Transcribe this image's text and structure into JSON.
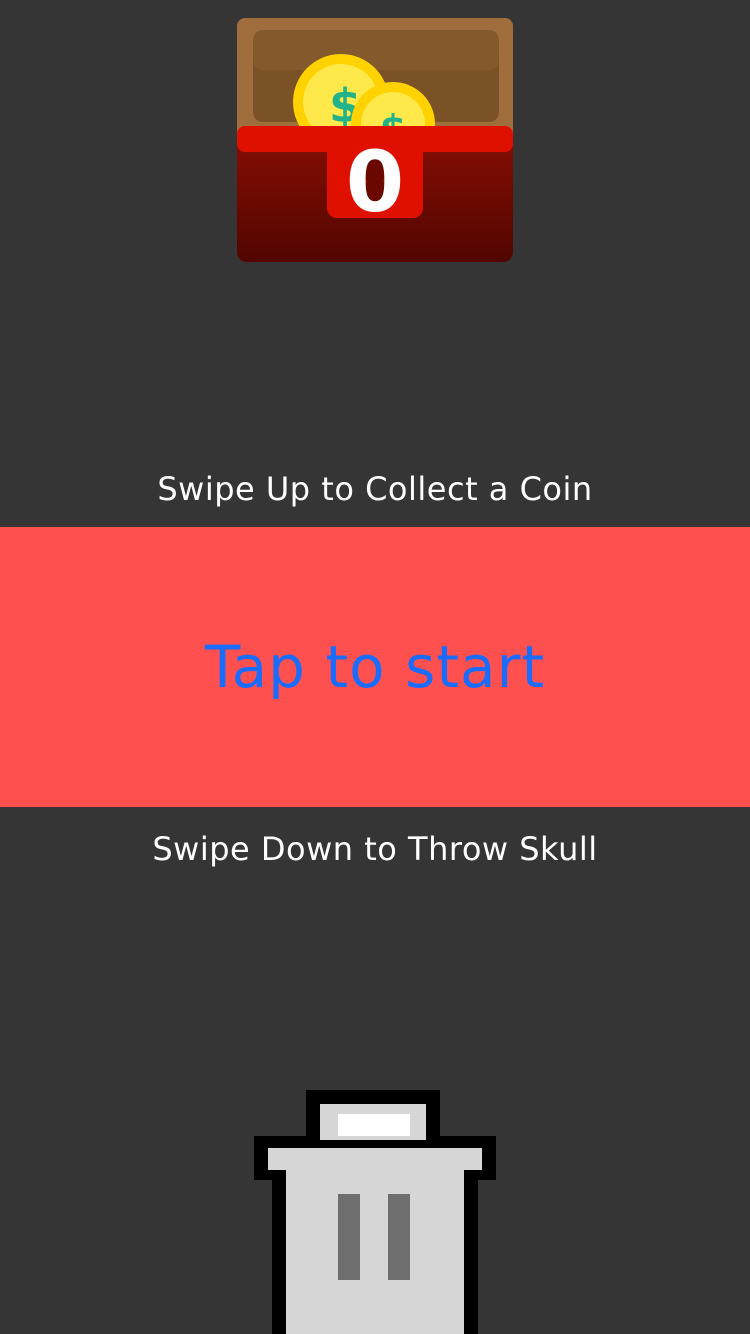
{
  "score": {
    "value": "0"
  },
  "hints": {
    "swipe_up": "Swipe Up to Collect a Coin",
    "swipe_down": "Swipe Down to Throw Skull"
  },
  "start": {
    "label": "Tap to start"
  },
  "icons": {
    "chest": "treasure-chest-icon",
    "coin": "coin-icon",
    "trash": "trash-can-icon"
  },
  "colors": {
    "background": "#353535",
    "start_band": "#ff5050",
    "start_text": "#1a6cff",
    "hint_text": "#ffffff",
    "chest_red": "#e01000",
    "coin_yellow": "#ffe600"
  }
}
